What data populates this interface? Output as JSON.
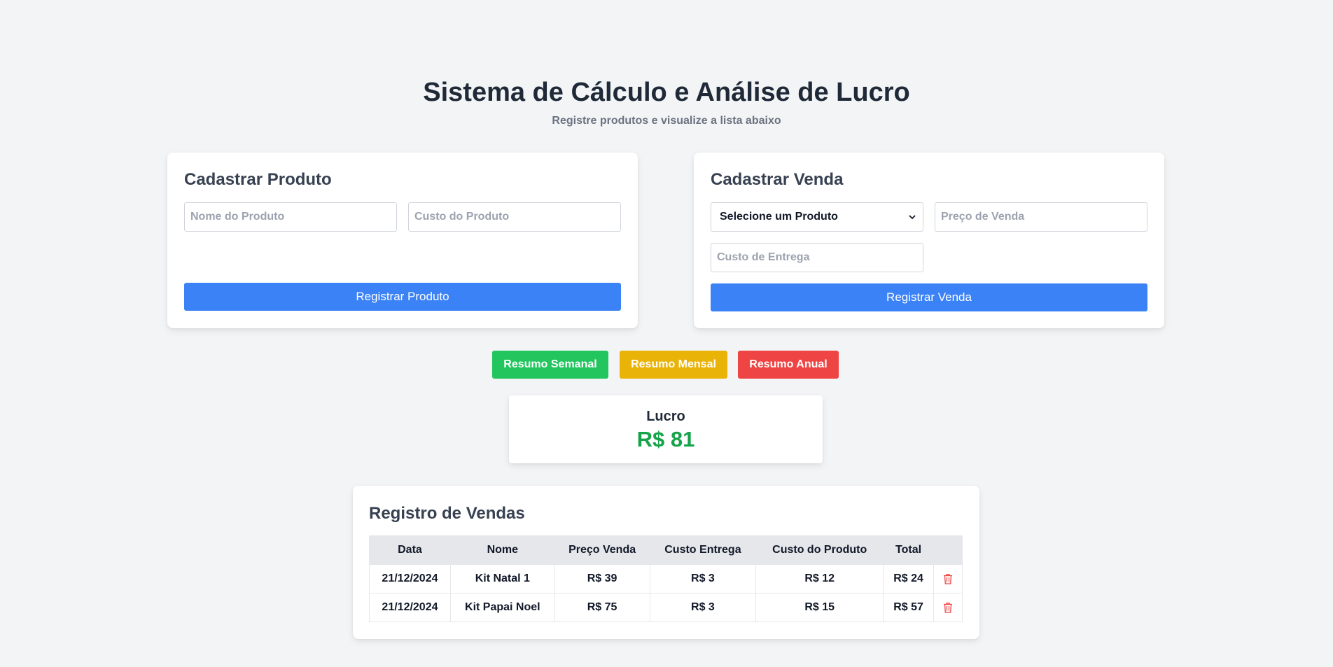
{
  "header": {
    "title": "Sistema de Cálculo e Análise de Lucro",
    "subtitle": "Registre produtos e visualize a lista abaixo"
  },
  "produto_form": {
    "title": "Cadastrar Produto",
    "nome_placeholder": "Nome do Produto",
    "custo_placeholder": "Custo do Produto",
    "submit_label": "Registrar Produto"
  },
  "venda_form": {
    "title": "Cadastrar Venda",
    "produto_select": "Selecione um Produto",
    "preco_placeholder": "Preço de Venda",
    "entrega_placeholder": "Custo de Entrega",
    "submit_label": "Registrar Venda"
  },
  "resumos": {
    "semanal": "Resumo Semanal",
    "mensal": "Resumo Mensal",
    "anual": "Resumo Anual"
  },
  "lucro": {
    "label": "Lucro",
    "value": "R$ 81"
  },
  "registro": {
    "title": "Registro de Vendas",
    "columns": [
      "Data",
      "Nome",
      "Preço Venda",
      "Custo Entrega",
      "Custo do Produto",
      "Total",
      ""
    ],
    "rows": [
      [
        "21/12/2024",
        "Kit Natal 1",
        "R$ 39",
        "R$ 3",
        "R$ 12",
        "R$ 24"
      ],
      [
        "21/12/2024",
        "Kit Papai Noel",
        "R$ 75",
        "R$ 3",
        "R$ 15",
        "R$ 57"
      ]
    ]
  },
  "colors": {
    "primary": "#3b82f6",
    "semanal": "#22c55e",
    "mensal": "#eab308",
    "anual": "#ef4444",
    "lucro": "#16a34a",
    "trash": "#ef4444"
  },
  "icons": {
    "select_chevron": "chevron-down-icon",
    "delete": "trash-icon"
  }
}
